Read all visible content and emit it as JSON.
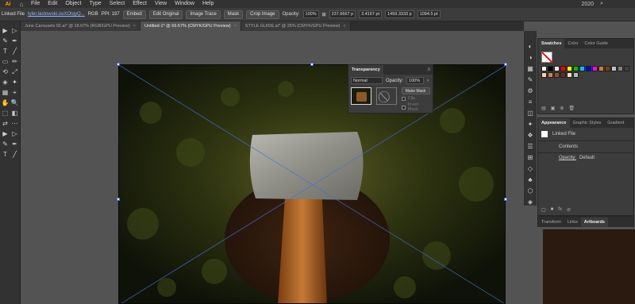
{
  "app": {
    "logo": "Ai",
    "menu": [
      "File",
      "Edit",
      "Object",
      "Type",
      "Select",
      "Effect",
      "View",
      "Window",
      "Help"
    ],
    "year": "2020"
  },
  "control_bar": {
    "selection_label": "Linked File",
    "file_link": "tyler.lastowski-zeXOtqyQ...",
    "color_info": "RGB",
    "ppi": "PPI: 197",
    "embed": "Embed",
    "edit_original": "Edit Original",
    "image_trace": "Image Trace",
    "mask": "Mask",
    "crop_image": "Crop Image",
    "opacity_label": "Opacity:",
    "opacity_value": "100%",
    "x_value": "237.6667 p",
    "y_value": "3.4167 pt",
    "w_value": "1459.3333 p",
    "h_value": "1094.5 pt"
  },
  "tabs": [
    {
      "label": "June Carousels 02.ai* @ 18.67% (RGB/GPU Preview)",
      "active": false
    },
    {
      "label": "Untitled-1* @ 66.67% (CMYK/GPU Preview)",
      "active": true
    },
    {
      "label": "STYLE GUIDE.ai* @ 25% (CMYK/GPU Preview)",
      "active": false
    }
  ],
  "transparency_panel": {
    "title": "Transparency",
    "blend_mode": "Normal",
    "opacity_label": "Opacity:",
    "opacity_value": "100%",
    "make_mask": "Make Mask",
    "clip": "Clip",
    "invert_mask": "Invert Mask"
  },
  "swatches_panel": {
    "tabs": [
      "Swatches",
      "Color",
      "Color Guide"
    ],
    "active_tab": "Swatches",
    "swatch_colors": [
      "#ffffff",
      "#000000",
      "#e8e8e8",
      "#ff0000",
      "#ffff00",
      "#00c000",
      "#00c0ff",
      "#0000ff",
      "#ff00ff",
      "#c08040",
      "#804000",
      "#c0c0c0",
      "#808080",
      "#404040",
      "#f0d0b0",
      "#d08050",
      "#905030",
      "#603020",
      "#f7e0c0",
      "#bbbbbb"
    ]
  },
  "appearance_panel": {
    "tabs": [
      "Appearance",
      "Graphic Styles",
      "Gradient"
    ],
    "active_tab": "Appearance",
    "object": "Linked File",
    "contents": "Contents",
    "opacity_label": "Opacity:",
    "opacity_value": "Default"
  },
  "bottom_panel": {
    "tabs": [
      "Transform",
      "Links",
      "Artboards"
    ],
    "active_tab": "Artboards"
  },
  "colors": {
    "accent": "#4a6cd4",
    "ui_dark": "#323232",
    "ui_mid": "#3c3c3c",
    "canvas": "#535353"
  }
}
